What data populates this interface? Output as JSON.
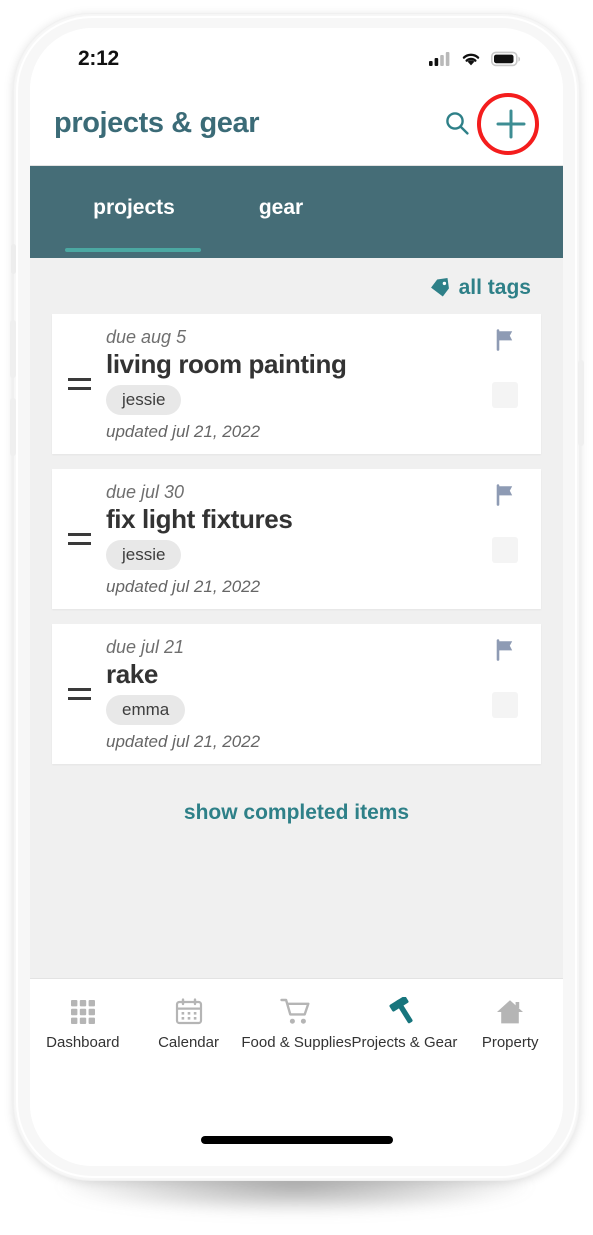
{
  "status_bar": {
    "time": "2:12",
    "icons": [
      "cellular-signal-icon",
      "wifi-icon",
      "battery-icon"
    ]
  },
  "header": {
    "title": "projects & gear",
    "search_icon": "search-icon",
    "add_icon": "plus-icon",
    "annotation": "red-circle-highlight-on-add-button"
  },
  "tabs": {
    "items": [
      {
        "label": "projects",
        "active": true
      },
      {
        "label": "gear",
        "active": false
      }
    ]
  },
  "toolbar": {
    "tags_label": "all tags",
    "tags_icon": "tag-icon"
  },
  "projects": [
    {
      "due": "due aug 5",
      "title": "living room painting",
      "tag": "jessie",
      "updated": "updated jul 21, 2022",
      "flag_icon": "flag-icon",
      "checkbox": "unchecked",
      "drag_handle": "drag-handle-icon"
    },
    {
      "due": "due jul 30",
      "title": "fix light fixtures",
      "tag": "jessie",
      "updated": "updated jul 21, 2022",
      "flag_icon": "flag-icon",
      "checkbox": "unchecked",
      "drag_handle": "drag-handle-icon"
    },
    {
      "due": "due jul 21",
      "title": "rake",
      "tag": "emma",
      "updated": "updated jul 21, 2022",
      "flag_icon": "flag-icon",
      "checkbox": "unchecked",
      "drag_handle": "drag-handle-icon"
    }
  ],
  "footer_link": {
    "label": "show completed items"
  },
  "bottom_nav": [
    {
      "label": "Dashboard",
      "icon": "grid-icon",
      "active": false
    },
    {
      "label": "Calendar",
      "icon": "calendar-icon",
      "active": false
    },
    {
      "label": "Food & Supplies",
      "icon": "shopping-cart-icon",
      "active": false
    },
    {
      "label": "Projects & Gear",
      "icon": "hammer-icon",
      "active": true
    },
    {
      "label": "Property",
      "icon": "house-icon",
      "active": false
    }
  ],
  "colors": {
    "brand_teal": "#2e8088",
    "header_title": "#3b6b77",
    "tab_bar_bg": "#456d77",
    "tab_underline": "#4ba8a2",
    "content_bg": "#f0f0f0",
    "card_bg": "#ffffff",
    "flag": "#8e9bb4",
    "annotation_red": "#f41d1d",
    "nav_inactive": "#b5b5b5"
  }
}
